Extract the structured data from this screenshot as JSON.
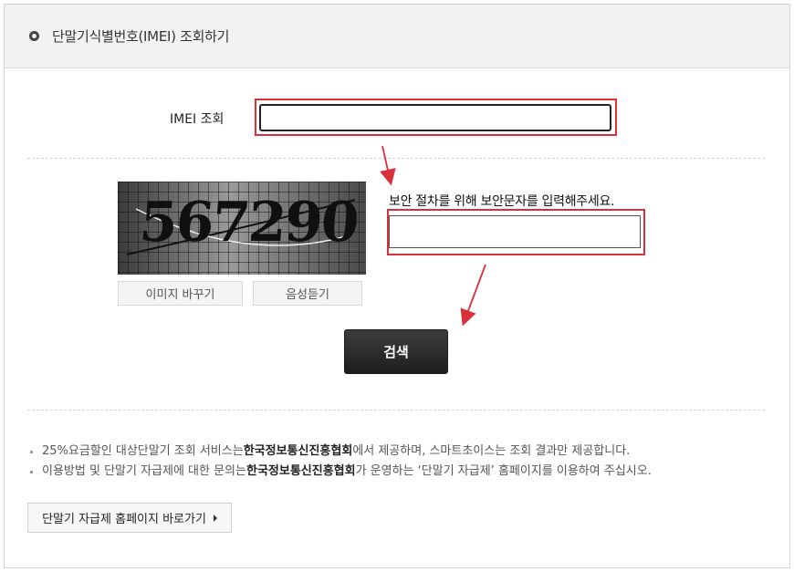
{
  "header": {
    "title": "단말기식별번호(IMEI) 조회하기",
    "icon": "circle-bullet-icon"
  },
  "form": {
    "imei_label": "IMEI 조회",
    "imei_value": "",
    "captcha_text": "567290",
    "change_image_label": "이미지 바꾸기",
    "listen_label": "음성듣기",
    "security_prompt": "보안 절차를 위해 보안문자를 입력해주세요.",
    "captcha_value": "",
    "search_label": "검색"
  },
  "notes": [
    {
      "prefix": "25%요금할인 대상단말기 조회 서비스는 ",
      "bold": "한국정보통신진흥협회",
      "suffix": "에서 제공하며, 스마트초이스는 조회 결과만 제공합니다."
    },
    {
      "prefix": "이용방법 및 단말기 자급제에 대한 문의는 ",
      "bold": "한국정보통신진흥협회",
      "suffix": "가 운영하는 ‘단말기 자급제’ 홈페이지를 이용하여 주십시오."
    }
  ],
  "link_button": {
    "label": "단말기 자급제 홈페이지 바로가기",
    "icon": "triangle-right-icon"
  },
  "colors": {
    "highlight": "#d9303b",
    "search_button": "#2a2a2a",
    "header_bg": "#f2f2f2"
  }
}
